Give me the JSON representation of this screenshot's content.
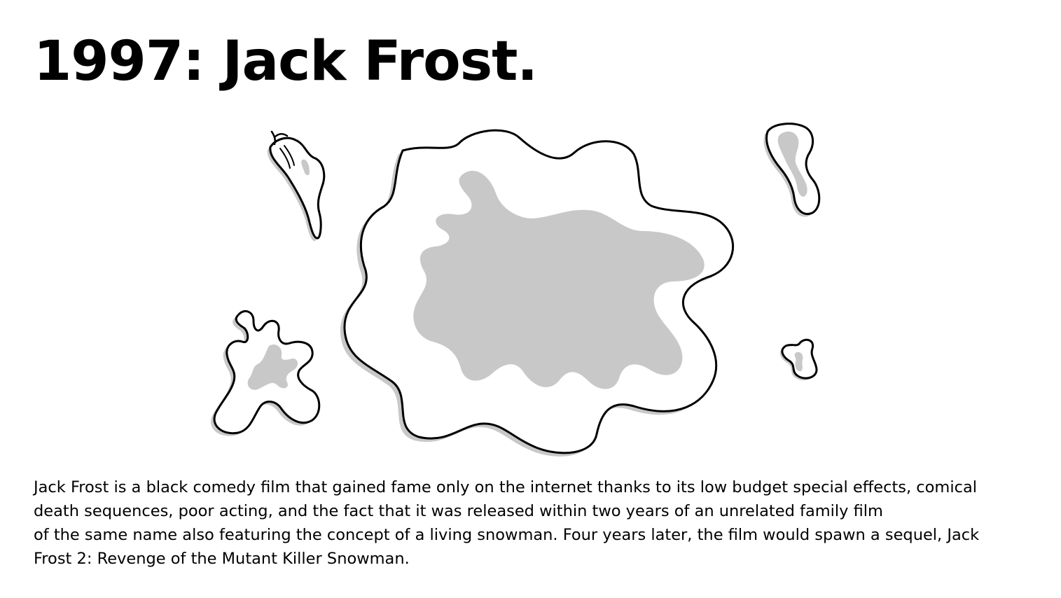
{
  "slide": {
    "title": "1997: Jack Frost.",
    "illustration_subject": "melted snow puddle",
    "caption_lines": [
      "Jack Frost is a black comedy film that gained fame only on the internet thanks to its low budget special effects, comical",
      "death sequences, poor acting, and the fact that it was released within two years of an unrelated family film",
      "of the same name also featuring the concept of a living snowman. Four years later, the film would spawn a sequel, Jack",
      "Frost 2: Revenge of the Mutant Killer Snowman."
    ]
  },
  "colors": {
    "background": "#ffffff",
    "outline": "#000000",
    "shadow": "#c8c8c8"
  }
}
